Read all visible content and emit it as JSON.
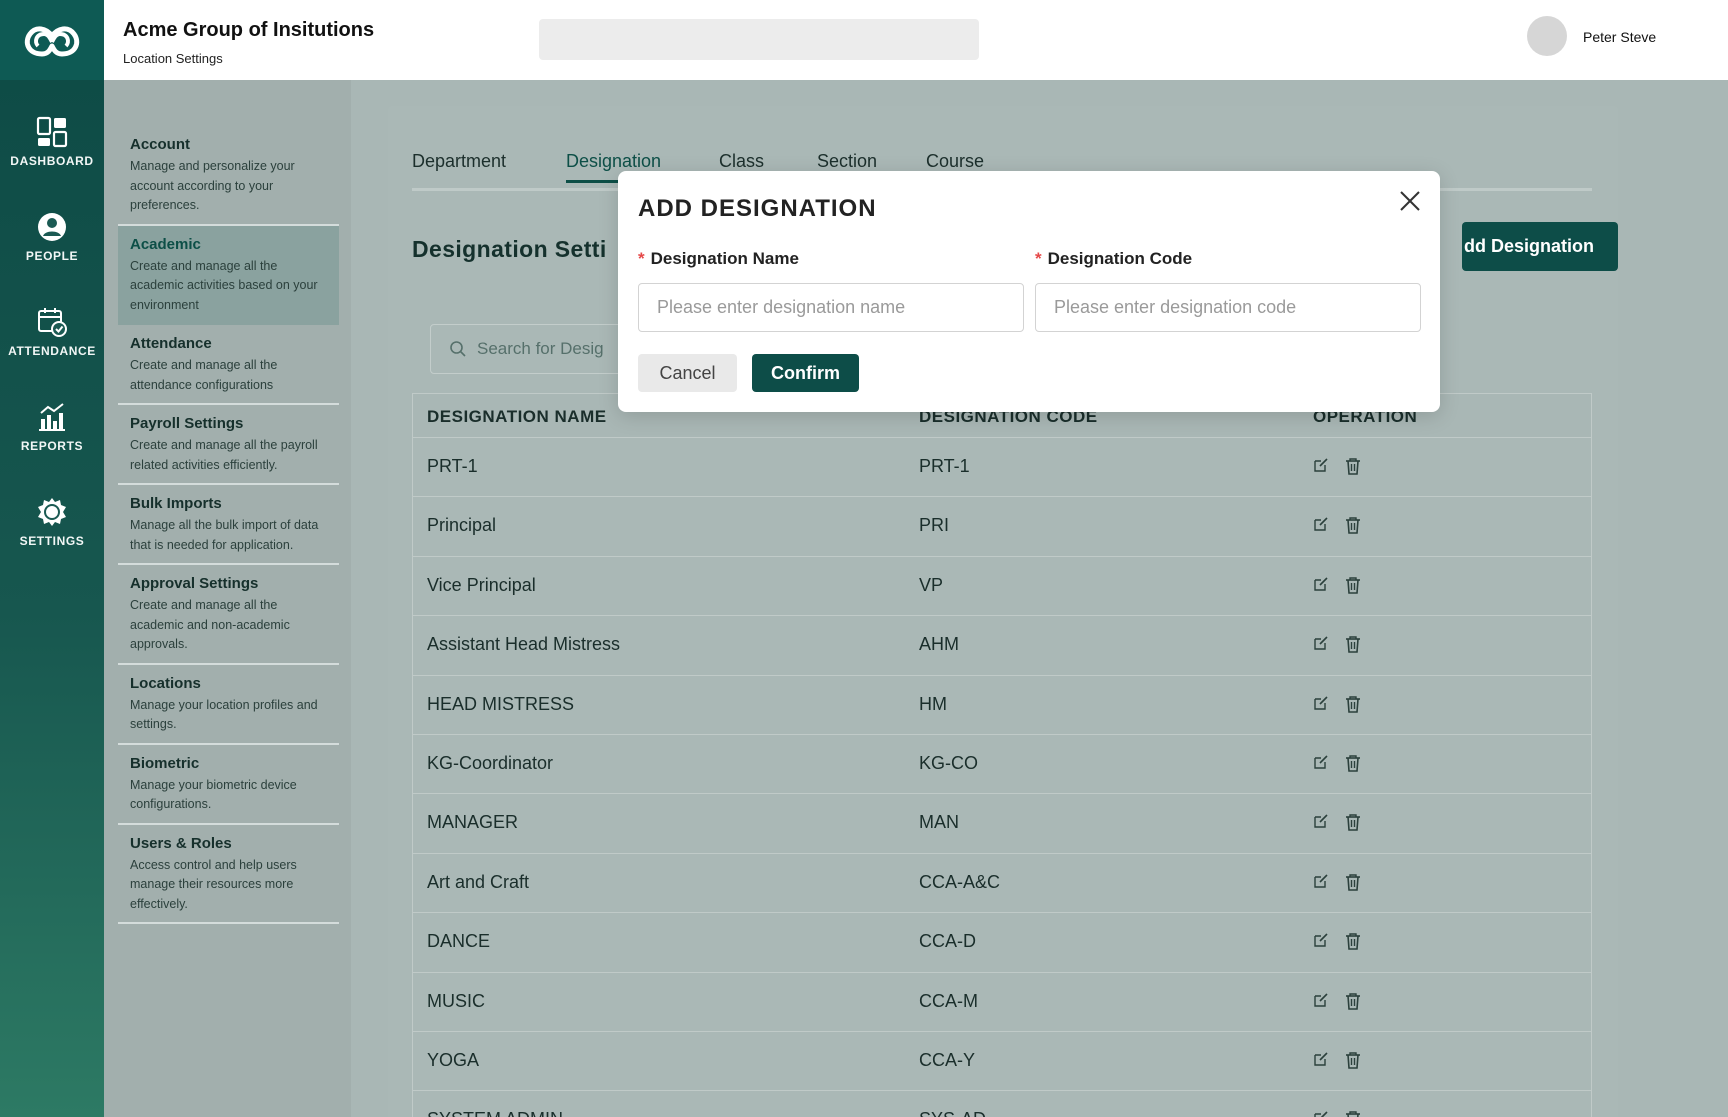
{
  "rail": {
    "items": [
      {
        "label": "DASHBOARD",
        "icon": "dashboard-icon"
      },
      {
        "label": "PEOPLE",
        "icon": "people-icon"
      },
      {
        "label": "ATTENDANCE",
        "icon": "attendance-icon"
      },
      {
        "label": "REPORTS",
        "icon": "reports-icon"
      },
      {
        "label": "SETTINGS",
        "icon": "settings-icon"
      }
    ]
  },
  "header": {
    "org": "Acme Group of Insitutions",
    "subtitle": "Location Settings",
    "user": "Peter Steve"
  },
  "settings_nav": [
    {
      "title": "Account",
      "desc": "Manage and personalize your account according to your preferences."
    },
    {
      "title": "Academic",
      "desc": "Create and manage all the academic activities based on your environment"
    },
    {
      "title": "Attendance",
      "desc": "Create and manage all the attendance configurations"
    },
    {
      "title": "Payroll Settings",
      "desc": "Create and manage all the payroll related activities efficiently."
    },
    {
      "title": "Bulk Imports",
      "desc": "Manage all the bulk import of data that is needed for application."
    },
    {
      "title": "Approval Settings",
      "desc": "Create and manage all the academic and non-academic approvals."
    },
    {
      "title": "Locations",
      "desc": "Manage your location profiles and settings."
    },
    {
      "title": "Biometric",
      "desc": "Manage your biometric device configurations."
    },
    {
      "title": "Users & Roles",
      "desc": "Access control and help users manage their resources more effectively."
    }
  ],
  "tabs": [
    "Department",
    "Designation",
    "Class",
    "Section",
    "Course"
  ],
  "section": {
    "title": "Designation Setti",
    "add_button": "dd Designation",
    "search_placeholder": "Search for Desig"
  },
  "table": {
    "headers": [
      "DESIGNATION NAME",
      "DESIGNATION CODE",
      "OPERATION"
    ],
    "rows": [
      {
        "name": "PRT-1",
        "code": "PRT-1"
      },
      {
        "name": "Principal",
        "code": "PRI"
      },
      {
        "name": "Vice Principal",
        "code": "VP"
      },
      {
        "name": "Assistant Head Mistress",
        "code": "AHM"
      },
      {
        "name": "HEAD MISTRESS",
        "code": "HM"
      },
      {
        "name": "KG-Coordinator",
        "code": "KG-CO"
      },
      {
        "name": "MANAGER",
        "code": "MAN"
      },
      {
        "name": "Art and Craft",
        "code": "CCA-A&C"
      },
      {
        "name": "DANCE",
        "code": "CCA-D"
      },
      {
        "name": "MUSIC",
        "code": "CCA-M"
      },
      {
        "name": "YOGA",
        "code": "CCA-Y"
      },
      {
        "name": "SYSTEM ADMIN",
        "code": "SYS-AD"
      }
    ]
  },
  "modal": {
    "title": "ADD DESIGNATION",
    "name_label": "Designation Name",
    "name_placeholder": "Please enter designation name",
    "code_label": "Designation Code",
    "code_placeholder": "Please enter designation code",
    "cancel": "Cancel",
    "confirm": "Confirm"
  }
}
